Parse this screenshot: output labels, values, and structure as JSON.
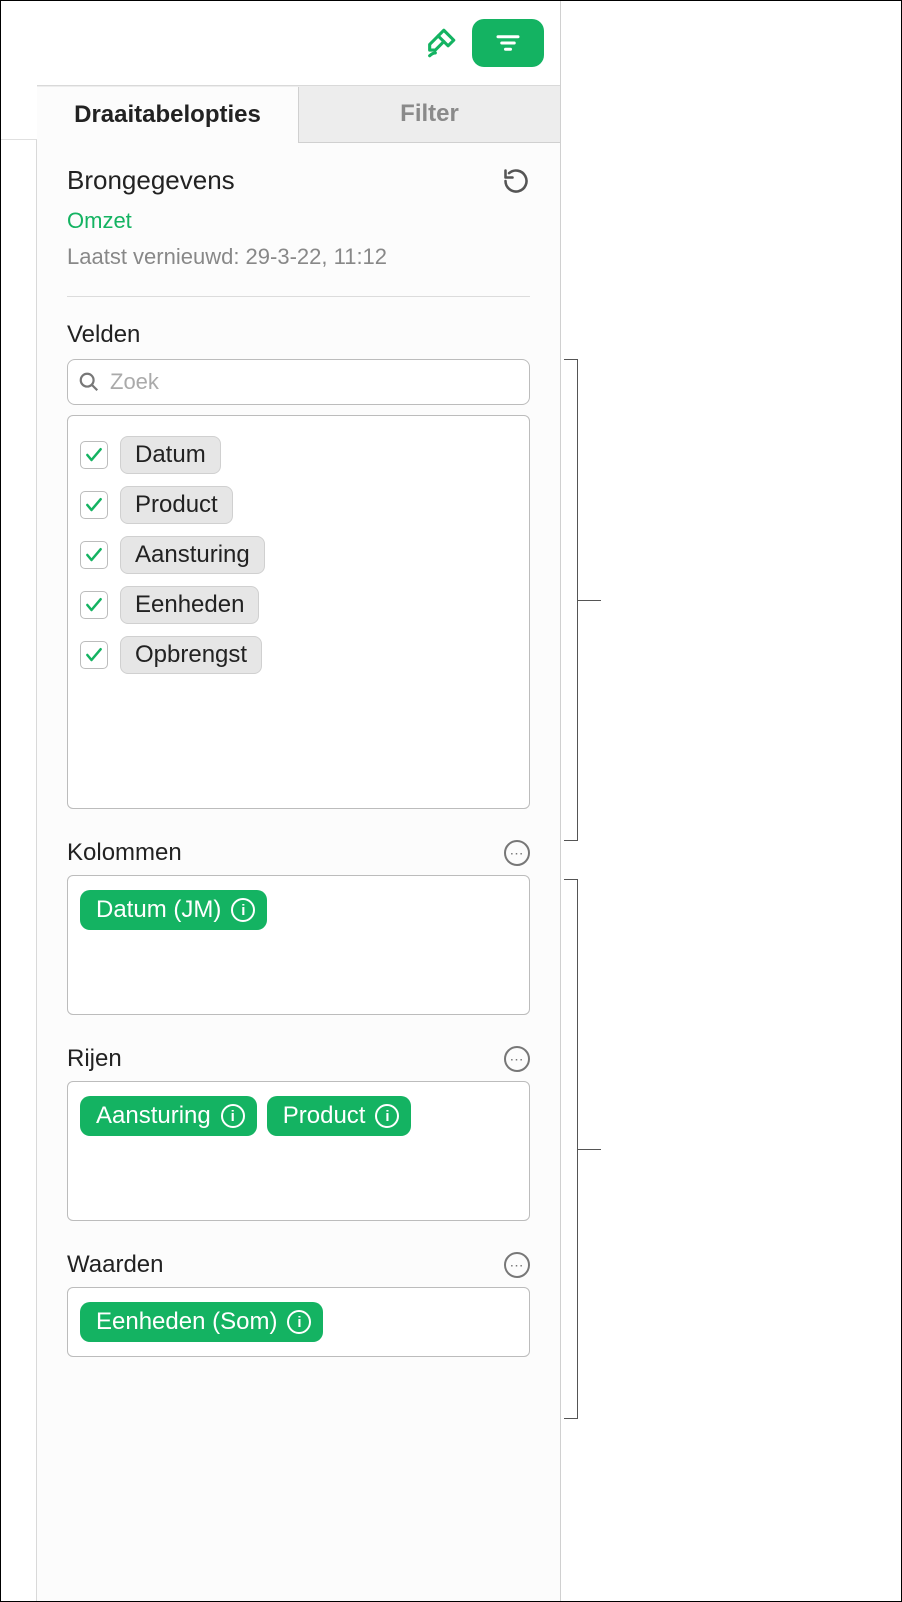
{
  "toolbar": {
    "brush_icon": "format-brush-icon",
    "filter_icon": "list-filter-icon"
  },
  "tabs": {
    "options": "Draaitabelopties",
    "filter": "Filter"
  },
  "source": {
    "heading": "Brongegevens",
    "link": "Omzet",
    "last_refresh": "Laatst vernieuwd: 29-3-22, 11:12"
  },
  "fields": {
    "label": "Velden",
    "search_placeholder": "Zoek",
    "items": [
      {
        "label": "Datum",
        "checked": true
      },
      {
        "label": "Product",
        "checked": true
      },
      {
        "label": "Aansturing",
        "checked": true
      },
      {
        "label": "Eenheden",
        "checked": true
      },
      {
        "label": "Opbrengst",
        "checked": true
      }
    ]
  },
  "columns": {
    "label": "Kolommen",
    "chips": [
      {
        "label": "Datum (JM)"
      }
    ]
  },
  "rows": {
    "label": "Rijen",
    "chips": [
      {
        "label": "Aansturing"
      },
      {
        "label": "Product"
      }
    ]
  },
  "values": {
    "label": "Waarden",
    "chips": [
      {
        "label": "Eenheden (Som)"
      }
    ]
  },
  "accent": "#14b362"
}
